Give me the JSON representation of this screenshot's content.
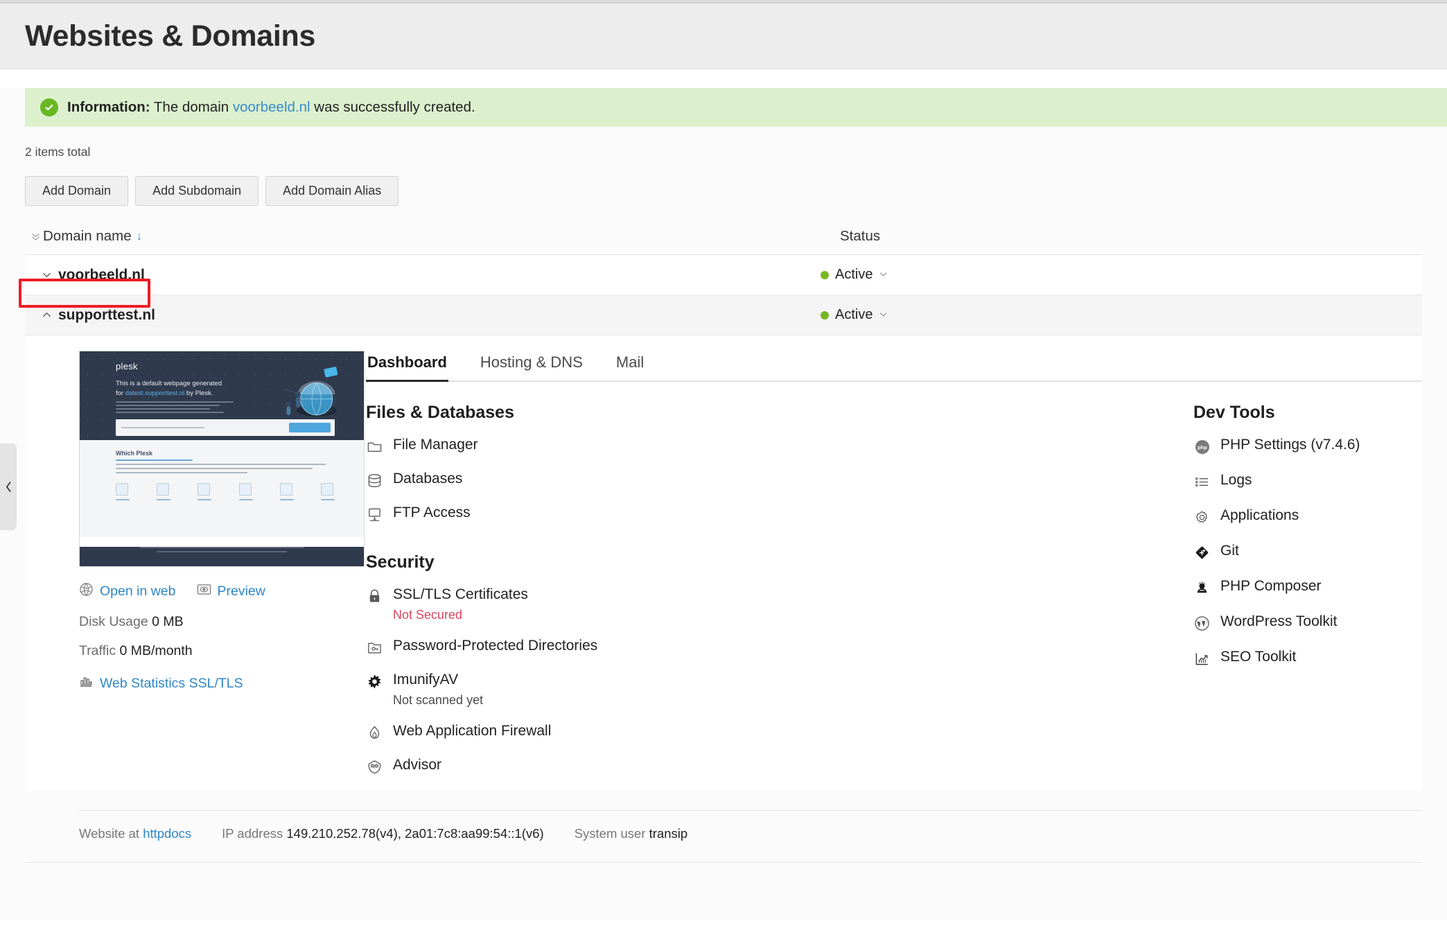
{
  "header": {
    "title": "Websites & Domains"
  },
  "banner": {
    "icon": "check-circle-icon",
    "label": "Information:",
    "text_before": " The domain ",
    "link": "voorbeeld.nl",
    "text_after": " was successfully created."
  },
  "list": {
    "items_total": "2 items total",
    "buttons": [
      {
        "label": "Add Domain",
        "name": "add-domain-button"
      },
      {
        "label": "Add Subdomain",
        "name": "add-subdomain-button"
      },
      {
        "label": "Add Domain Alias",
        "name": "add-domain-alias-button"
      }
    ],
    "columns": {
      "domain_name": "Domain name",
      "status": "Status",
      "sort_arrow": "↓"
    },
    "rows": [
      {
        "name": "voorbeeld.nl",
        "status": "Active",
        "expanded": false,
        "chevron": "∨",
        "highlighted": true
      },
      {
        "name": "supporttest.nl",
        "status": "Active",
        "expanded": true,
        "chevron": "∧",
        "highlighted": false
      }
    ]
  },
  "detail": {
    "thumbnail": {
      "logo": "plesk",
      "headline_1": "This is a default webpage generated for",
      "headline_link": "datest.supporttest.nl",
      "headline_2": " by Plesk.",
      "body_title": "Which Plesk"
    },
    "open_in_web": "Open in web",
    "preview": "Preview",
    "disk_usage_label": "Disk Usage",
    "disk_usage_value": "0 MB",
    "traffic_label": "Traffic",
    "traffic_value": "0 MB/month",
    "web_statistics": "Web Statistics SSL/TLS",
    "tabs": [
      {
        "label": "Dashboard",
        "active": true
      },
      {
        "label": "Hosting & DNS",
        "active": false
      },
      {
        "label": "Mail",
        "active": false
      }
    ],
    "files_databases": {
      "title": "Files & Databases",
      "items": [
        {
          "label": "File Manager",
          "icon": "folder-icon"
        },
        {
          "label": "Databases",
          "icon": "database-icon"
        },
        {
          "label": "FTP Access",
          "icon": "ftp-monitor-icon"
        }
      ]
    },
    "security": {
      "title": "Security",
      "items": [
        {
          "label": "SSL/TLS Certificates",
          "icon": "lock-icon",
          "note": "Not Secured",
          "note_color": "#d9455f"
        },
        {
          "label": "Password-Protected Directories",
          "icon": "folder-key-icon",
          "note": ""
        },
        {
          "label": "ImunifyAV",
          "icon": "imunify-star-icon",
          "note": "Not scanned yet",
          "note_color": "#4a4a4a"
        },
        {
          "label": "Web Application Firewall",
          "icon": "flame-icon",
          "note": ""
        },
        {
          "label": "Advisor",
          "icon": "owl-icon",
          "note": ""
        }
      ]
    },
    "dev_tools": {
      "title": "Dev Tools",
      "items": [
        {
          "label": "PHP Settings (v7.4.6)",
          "icon": "php-icon"
        },
        {
          "label": "Logs",
          "icon": "list-icon"
        },
        {
          "label": "Applications",
          "icon": "gear-icon"
        },
        {
          "label": "Git",
          "icon": "git-icon"
        },
        {
          "label": "PHP Composer",
          "icon": "composer-icon"
        },
        {
          "label": "WordPress Toolkit",
          "icon": "wordpress-icon"
        },
        {
          "label": "SEO Toolkit",
          "icon": "seo-chart-icon"
        }
      ]
    },
    "meta": {
      "website_at_label": "Website at",
      "website_at_value": "httpdocs",
      "ip_label": "IP address",
      "ip_value": "149.210.252.78(v4), 2a01:7c8:aa99:54::1(v6)",
      "system_user_label": "System user",
      "system_user_value": "transip"
    }
  },
  "colors": {
    "accent_link": "#2e86c8",
    "status_green": "#76b724",
    "banner_bg": "#dcf0cd",
    "danger": "#d9455f",
    "highlight_border": "#ee1c25"
  },
  "sidebar_handle": {
    "icon": "chevron-left-icon"
  }
}
